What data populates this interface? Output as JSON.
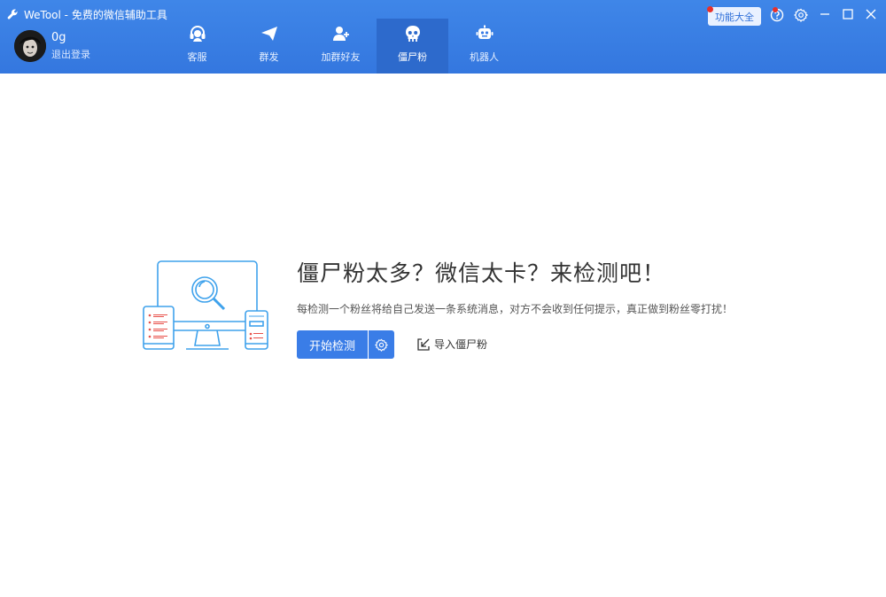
{
  "window": {
    "title": "WeTool - 免费的微信辅助工具",
    "feature_button": "功能大全"
  },
  "user": {
    "name": "0g",
    "logout_label": "退出登录"
  },
  "nav": [
    {
      "label": "客服",
      "icon": "headset-icon"
    },
    {
      "label": "群发",
      "icon": "paper-plane-icon"
    },
    {
      "label": "加群好友",
      "icon": "add-user-icon"
    },
    {
      "label": "僵尸粉",
      "icon": "skull-icon",
      "active": true
    },
    {
      "label": "机器人",
      "icon": "robot-icon"
    }
  ],
  "main": {
    "headline": "僵尸粉太多？微信太卡？来检测吧！",
    "description": "每检测一个粉丝将给自己发送一条系统消息，对方不会收到任何提示，真正做到粉丝零打扰！",
    "start_button": "开始检测",
    "import_link": "导入僵尸粉"
  },
  "colors": {
    "header": "#3a7de7",
    "accent": "#3a7de7",
    "illustration": "#3fa2ec",
    "notification": "#e8302a"
  }
}
